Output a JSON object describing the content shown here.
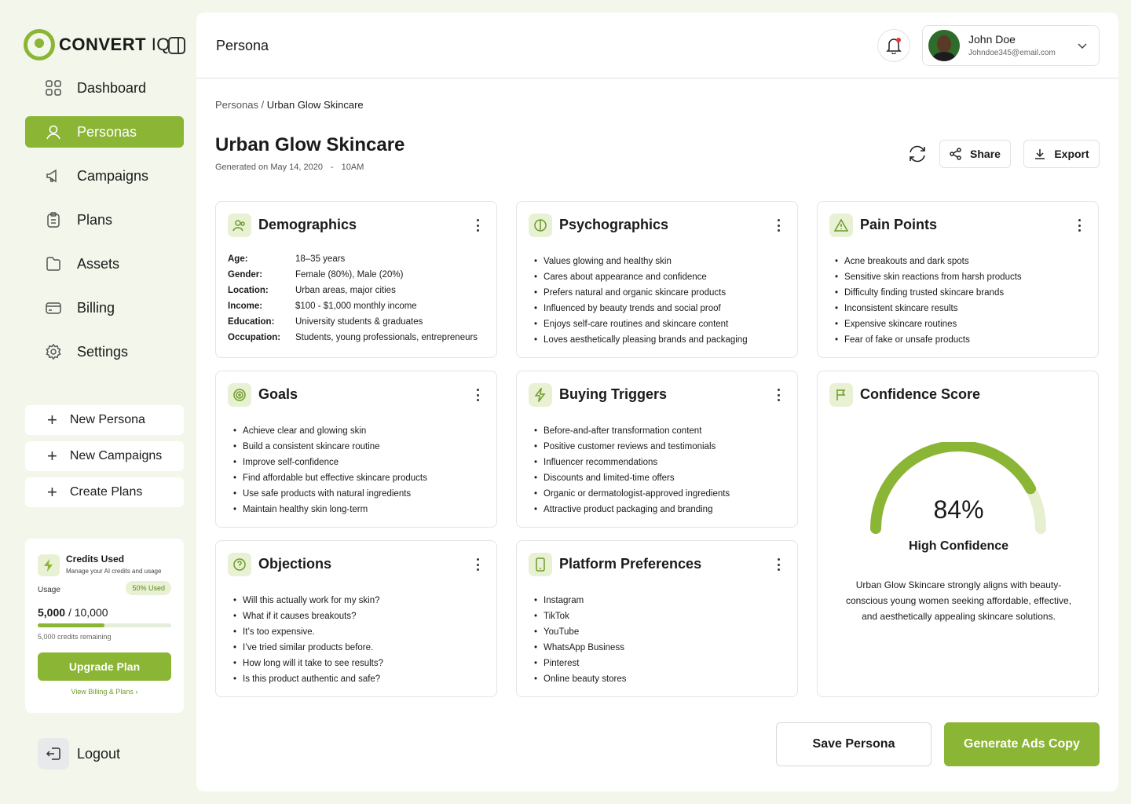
{
  "brand": {
    "name_bold": "CONVERT",
    "name_light": "IQ",
    "accent": "#8bb534"
  },
  "sidebar": {
    "items": [
      {
        "label": "Dashboard",
        "icon": "grid-icon"
      },
      {
        "label": "Personas",
        "icon": "user-icon",
        "active": true
      },
      {
        "label": "Campaigns",
        "icon": "megaphone-icon"
      },
      {
        "label": "Plans",
        "icon": "clipboard-icon"
      },
      {
        "label": "Assets",
        "icon": "folder-icon"
      },
      {
        "label": "Billing",
        "icon": "card-icon"
      },
      {
        "label": "Settings",
        "icon": "gear-icon"
      }
    ],
    "quick_actions": [
      "New Persona",
      "New Campaigns",
      "Create Plans"
    ],
    "credits": {
      "title": "Credits Used",
      "subtitle": "Manage your AI credits and usage",
      "usage_label": "Usage",
      "used_pill": "50% Used",
      "used": "5,000",
      "total": "/ 10,000",
      "progress": 0.5,
      "remaining": "5,000 credits remaining",
      "upgrade_label": "Upgrade Plan",
      "billing_link": "View Billing & Plans"
    },
    "logout_label": "Logout"
  },
  "header": {
    "page_label": "Persona",
    "user": {
      "name": "John Doe",
      "email": "Johndoe345@email.com"
    }
  },
  "breadcrumb": {
    "parent": "Personas",
    "separator": "/",
    "current": "Urban Glow Skincare"
  },
  "persona": {
    "title": "Urban Glow Skincare",
    "generated": "Generated on May 14, 2020",
    "dash": "-",
    "time": "10AM"
  },
  "actions": {
    "share_label": "Share",
    "export_label": "Export"
  },
  "cards": {
    "demographics": {
      "title": "Demographics",
      "rows": [
        {
          "k": "Age:",
          "v": "18–35 years"
        },
        {
          "k": "Gender:",
          "v": "Female (80%), Male (20%)"
        },
        {
          "k": "Location:",
          "v": "Urban areas, major cities"
        },
        {
          "k": "Income:",
          "v": "$100 - $1,000 monthly income"
        },
        {
          "k": "Education:",
          "v": "University students & graduates"
        },
        {
          "k": "Occupation:",
          "v": "Students, young professionals, entrepreneurs"
        }
      ]
    },
    "psychographics": {
      "title": "Psychographics",
      "items": [
        "Values glowing and healthy skin",
        "Cares about appearance and confidence",
        "Prefers natural and organic skincare products",
        "Influenced by beauty trends and social proof",
        "Enjoys self-care routines and skincare content",
        "Loves aesthetically pleasing brands and packaging"
      ]
    },
    "pain_points": {
      "title": "Pain Points",
      "items": [
        "Acne breakouts and dark spots",
        "Sensitive skin reactions from harsh products",
        "Difficulty finding trusted skincare brands",
        "Inconsistent skincare results",
        "Expensive skincare routines",
        "Fear of fake or unsafe products"
      ]
    },
    "goals": {
      "title": "Goals",
      "items": [
        "Achieve clear and glowing skin",
        "Build a consistent skincare routine",
        "Improve self-confidence",
        "Find affordable but effective skincare products",
        "Use safe products with natural ingredients",
        "Maintain healthy skin long-term"
      ]
    },
    "buying_triggers": {
      "title": "Buying Triggers",
      "items": [
        "Before-and-after transformation content",
        "Positive customer reviews and testimonials",
        "Influencer recommendations",
        "Discounts and limited-time offers",
        "Organic or dermatologist-approved ingredients",
        "Attractive product packaging and branding"
      ]
    },
    "objections": {
      "title": "Objections",
      "items": [
        "Will this actually work for my skin?",
        "What if it causes breakouts?",
        "It’s too expensive.",
        "I’ve tried similar products before.",
        "How long will it take to see results?",
        "Is this product authentic and safe?"
      ]
    },
    "platforms": {
      "title": "Platform Preferences",
      "items": [
        "Instagram",
        "TikTok",
        "YouTube",
        "WhatsApp Business",
        "Pinterest",
        "Online beauty stores"
      ]
    }
  },
  "confidence": {
    "title": "Confidence Score",
    "score": 84,
    "score_label": "84%",
    "level": "High Confidence",
    "description": "Urban Glow Skincare strongly aligns with beauty-conscious young women seeking affordable, effective, and aesthetically appealing skincare solutions."
  },
  "footer": {
    "save_label": "Save Persona",
    "generate_label": "Generate Ads Copy"
  }
}
